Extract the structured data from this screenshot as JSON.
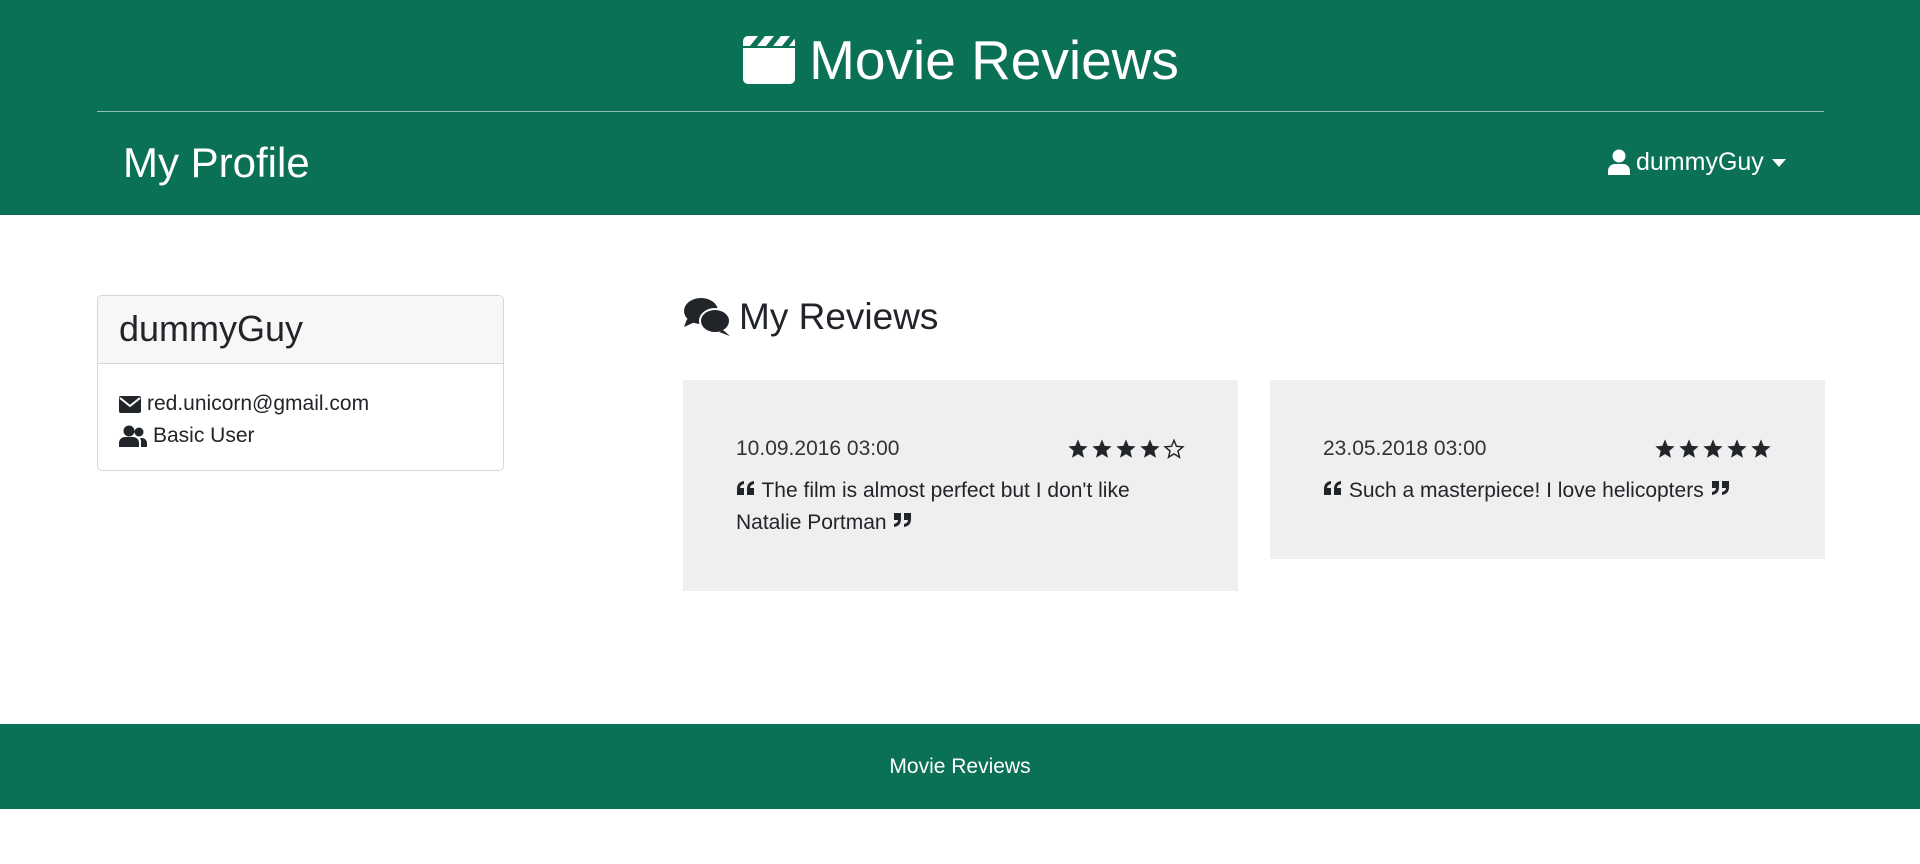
{
  "header": {
    "brand_title": "Movie Reviews",
    "brand_icon": "clapperboard-icon",
    "page_title": "My Profile",
    "user_menu_label": "dummyGuy",
    "user_icon": "user-icon"
  },
  "profile": {
    "username": "dummyGuy",
    "email": "red.unicorn@gmail.com",
    "role": "Basic User",
    "email_icon": "envelope-icon",
    "role_icon": "users-icon"
  },
  "reviews_section": {
    "heading": "My Reviews",
    "heading_icon": "comments-icon",
    "reviews": [
      {
        "date": "10.09.2016 03:00",
        "rating": 4,
        "max_rating": 5,
        "text": "The film is almost perfect but I don't like Natalie Portman"
      },
      {
        "date": "23.05.2018 03:00",
        "rating": 5,
        "max_rating": 5,
        "text": "Such a masterpiece! I love helicopters"
      }
    ]
  },
  "footer": {
    "text": "Movie Reviews"
  },
  "colors": {
    "brand_green": "#0b7156",
    "card_bg": "#efefef",
    "text_dark": "#212529"
  }
}
